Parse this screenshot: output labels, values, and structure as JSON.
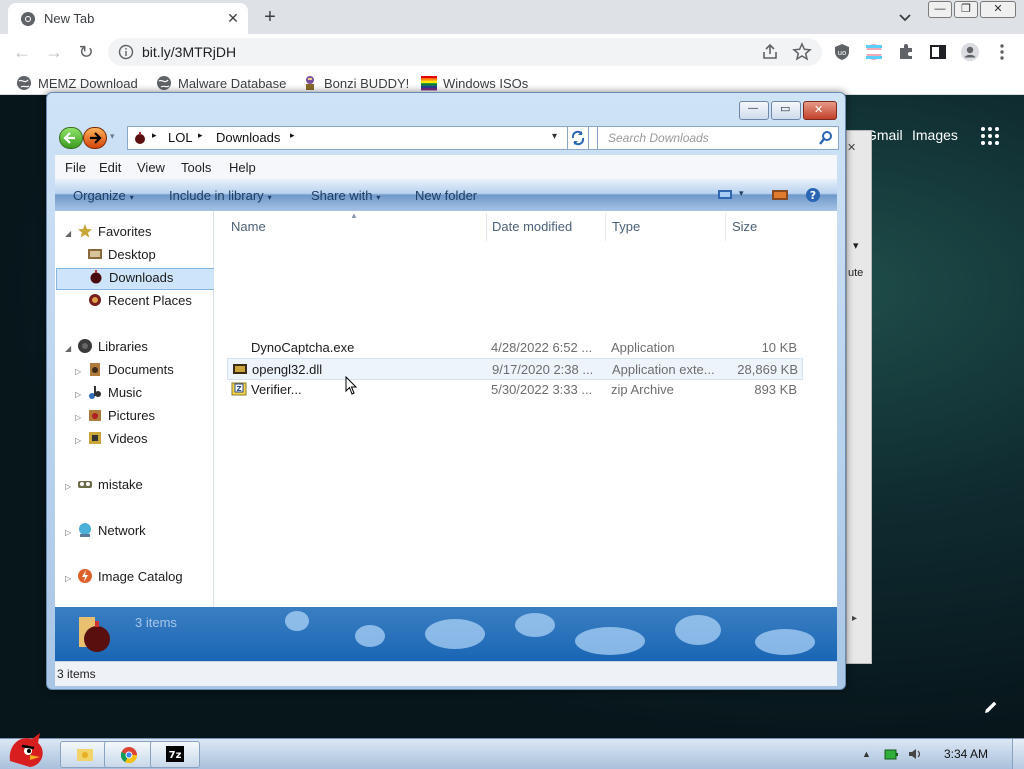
{
  "browser": {
    "tab": {
      "title": "New Tab",
      "close": "✕"
    },
    "new_tab": "+",
    "window_controls": {
      "minimize": "—",
      "restore": "❐",
      "close": "✕"
    },
    "toolbar": {
      "back": "←",
      "forward": "→",
      "reload": "↻"
    },
    "omnibox": {
      "url": "bit.ly/3MTRjDH"
    },
    "bookmarks": [
      {
        "label": "MEMZ Download",
        "icon": "globe-icon"
      },
      {
        "label": "Malware Database",
        "icon": "globe-icon"
      },
      {
        "label": "Bonzi BUDDY!",
        "icon": "bonzi-icon"
      },
      {
        "label": "Windows ISOs",
        "icon": "windows-flag-icon"
      }
    ]
  },
  "page": {
    "links": {
      "gmail": "Gmail",
      "images": "Images"
    },
    "behind_dialog": {
      "chevron": "▾",
      "truncated": "ute",
      "close": "✕",
      "scroll": "▸"
    }
  },
  "explorer": {
    "caption": {
      "minimize": "—",
      "maximize": "▭",
      "close": "✕"
    },
    "address": {
      "segments": [
        "LOL",
        "Downloads"
      ],
      "separator": "▸"
    },
    "search": {
      "placeholder": "Search Downloads"
    },
    "menu": [
      "File",
      "Edit",
      "View",
      "Tools",
      "Help"
    ],
    "commands": [
      {
        "label": "Organize",
        "dropdown": true
      },
      {
        "label": "Include in library",
        "dropdown": true
      },
      {
        "label": "Share with",
        "dropdown": true
      },
      {
        "label": "New folder",
        "dropdown": false
      }
    ],
    "dropdown_glyph": "▾",
    "nav": {
      "favorites": {
        "label": "Favorites",
        "items": [
          "Desktop",
          "Downloads",
          "Recent Places"
        ]
      },
      "libraries": {
        "label": "Libraries",
        "items": [
          "Documents",
          "Music",
          "Pictures",
          "Videos"
        ]
      },
      "mistake": "mistake",
      "network": "Network",
      "catalog": "Image Catalog",
      "selected": "Downloads"
    },
    "columns": {
      "name": "Name",
      "date": "Date modified",
      "type": "Type",
      "size": "Size"
    },
    "files": [
      {
        "name": "DynoCaptcha.exe",
        "date": "4/28/2022 6:52 ...",
        "type": "Application",
        "size": "10 KB"
      },
      {
        "name": "opengl32.dll",
        "date": "9/17/2020 2:38 ...",
        "type": "Application exte...",
        "size": "28,869 KB"
      },
      {
        "name": "Verifier...",
        "date": "5/30/2022 3:33 ...",
        "type": "zip Archive",
        "size": "893 KB"
      }
    ],
    "details": {
      "count": "3 items"
    },
    "status": {
      "count": "3 items"
    }
  },
  "taskbar": {
    "clock": "3:34 AM",
    "tray_arrow": "▲",
    "app_7z": "7z"
  },
  "colors": {
    "selection": "#cde4fb",
    "window_frame": "#a9c6e6",
    "chrome_tabstrip": "#dee1e6"
  }
}
